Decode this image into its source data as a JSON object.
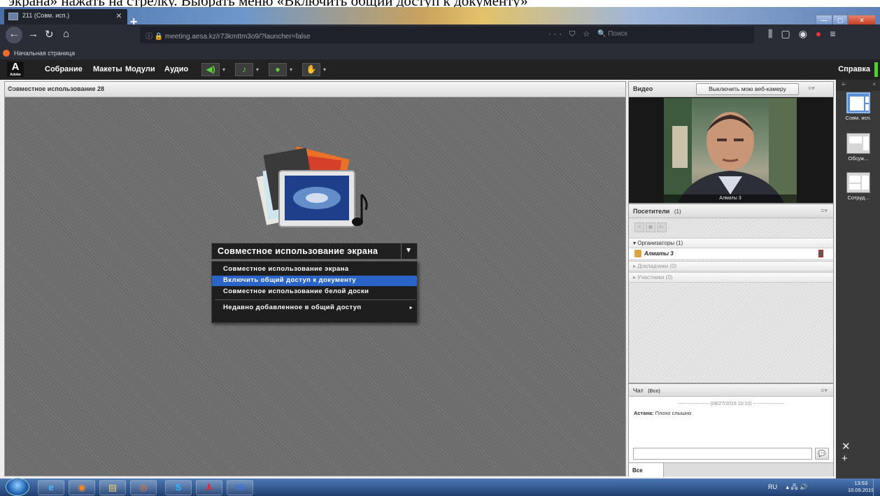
{
  "caption": {
    "text": "экрана» нажать на стрелку. Выбрать меню «Включить общий доступ к документу»"
  },
  "browser": {
    "tab_title": "211 (Совм. исп.)",
    "tab_close": "×",
    "new_tab": "+",
    "url": "ⓘ 🔒  meeting.aesa.kz/r73kmttm3o9/?launcher=false",
    "url_actions": "··· ⛉ ☆",
    "search_placeholder": "🔍 Поиск",
    "bookmark": "Начальная страница",
    "right_icons": [
      "⫼",
      "▢",
      "◉",
      "●",
      "≡"
    ],
    "win_buttons": [
      "—",
      "▢",
      "✕"
    ]
  },
  "connect_menu": {
    "items": [
      "Собрание",
      "Макеты",
      "Модули",
      "Аудио"
    ],
    "help": "Справка",
    "logo_top": "A",
    "logo_bottom": "Adobe"
  },
  "share_pod": {
    "title": "Совместное использование 28",
    "menu_icon": "≡▾",
    "share_button": "Совместное использование экрана",
    "share_arrow": "▾",
    "menu": [
      "Совместное использование экрана",
      "Включить общий доступ к документу",
      "Совместное использование белой доски"
    ],
    "menu_selected": "Включить общий доступ к документу",
    "recent": "Недавно добавленное в общий доступ",
    "recent_arrow": "▸"
  },
  "video_pod": {
    "title": "Видео",
    "webcam_button": "Выключить мою веб-камеру",
    "menu_icon": "≡▾",
    "camera_name": "Алматы 3"
  },
  "attendees": {
    "title": "Посетители",
    "count": "(1)",
    "menu_icon": "≡▾",
    "groups": [
      {
        "label": "▾ Организаторы (1)"
      },
      {
        "label": "▸ Докладчики (0)"
      },
      {
        "label": "▸ Участники (0)"
      }
    ],
    "host": "Алматы 3"
  },
  "chat": {
    "title": "Чат",
    "scope": "(Все)",
    "menu_icon": "≡▾",
    "date_line": "------------------- (08/27/2019 10:10) -------------------",
    "sender": "Астана:",
    "message": "Плохо слышно",
    "send_icon": "💬",
    "tab_all": "Все"
  },
  "layouts": {
    "top_left": "≡·",
    "top_right": "×",
    "items": [
      "Совм. исп.",
      "Обсуж...",
      "Сотруд..."
    ],
    "bottom": "✕ +"
  },
  "taskbar": {
    "apps": [
      "e",
      "◉",
      "▤",
      "◎",
      "S",
      "⅄",
      "W"
    ],
    "lang": "RU",
    "tray_icons": "▴ 🖧 🔊",
    "time": "13:53",
    "date": "10.09.2019"
  },
  "colors": {
    "accent_selected": "#2a64c8",
    "audio_green": "#5fd23b",
    "adobe_menu": "#222222"
  }
}
